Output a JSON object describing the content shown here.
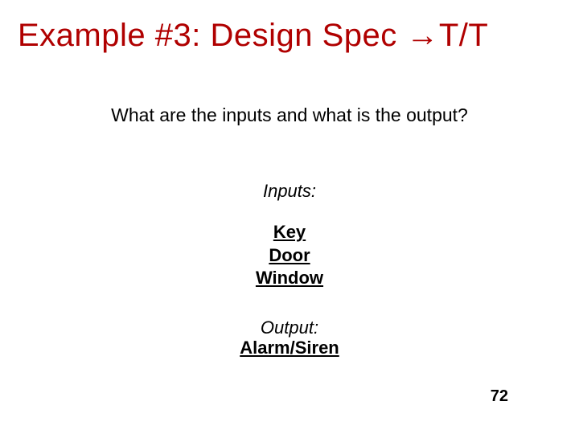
{
  "title": "Example #3: Design Spec →T/T",
  "subtitle": "What are the inputs and what is the output?",
  "inputsLabel": "Inputs:",
  "inputs": [
    "Key",
    "Door",
    "Window"
  ],
  "outputLabel": "Output:",
  "outputValue": "Alarm/Siren",
  "pageNumber": "72"
}
